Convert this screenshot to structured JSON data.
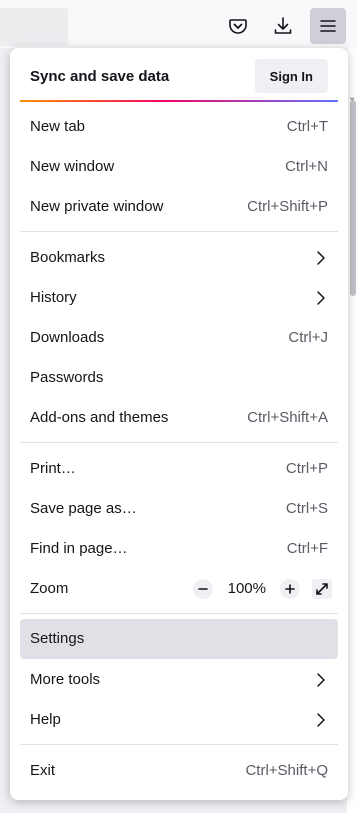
{
  "toolbar": {
    "icons": [
      "pocket-icon",
      "download-icon",
      "hamburger-menu-icon"
    ]
  },
  "menu": {
    "sync": {
      "title": "Sync and save data",
      "signin_label": "Sign In"
    },
    "items": {
      "new_tab": {
        "label": "New tab",
        "shortcut": "Ctrl+T"
      },
      "new_window": {
        "label": "New window",
        "shortcut": "Ctrl+N"
      },
      "new_private": {
        "label": "New private window",
        "shortcut": "Ctrl+Shift+P"
      },
      "bookmarks": {
        "label": "Bookmarks"
      },
      "history": {
        "label": "History"
      },
      "downloads": {
        "label": "Downloads",
        "shortcut": "Ctrl+J"
      },
      "passwords": {
        "label": "Passwords"
      },
      "addons": {
        "label": "Add-ons and themes",
        "shortcut": "Ctrl+Shift+A"
      },
      "print": {
        "label": "Print…",
        "shortcut": "Ctrl+P"
      },
      "save_page": {
        "label": "Save page as…",
        "shortcut": "Ctrl+S"
      },
      "find": {
        "label": "Find in page…",
        "shortcut": "Ctrl+F"
      },
      "zoom": {
        "label": "Zoom",
        "value": "100%"
      },
      "settings": {
        "label": "Settings"
      },
      "more_tools": {
        "label": "More tools"
      },
      "help": {
        "label": "Help"
      },
      "exit": {
        "label": "Exit",
        "shortcut": "Ctrl+Shift+Q"
      }
    }
  },
  "colors": {
    "accent_gradient": [
      "#ff9100",
      "#f10366",
      "#6173ff"
    ],
    "hover_bg": "#e0e0e6"
  }
}
